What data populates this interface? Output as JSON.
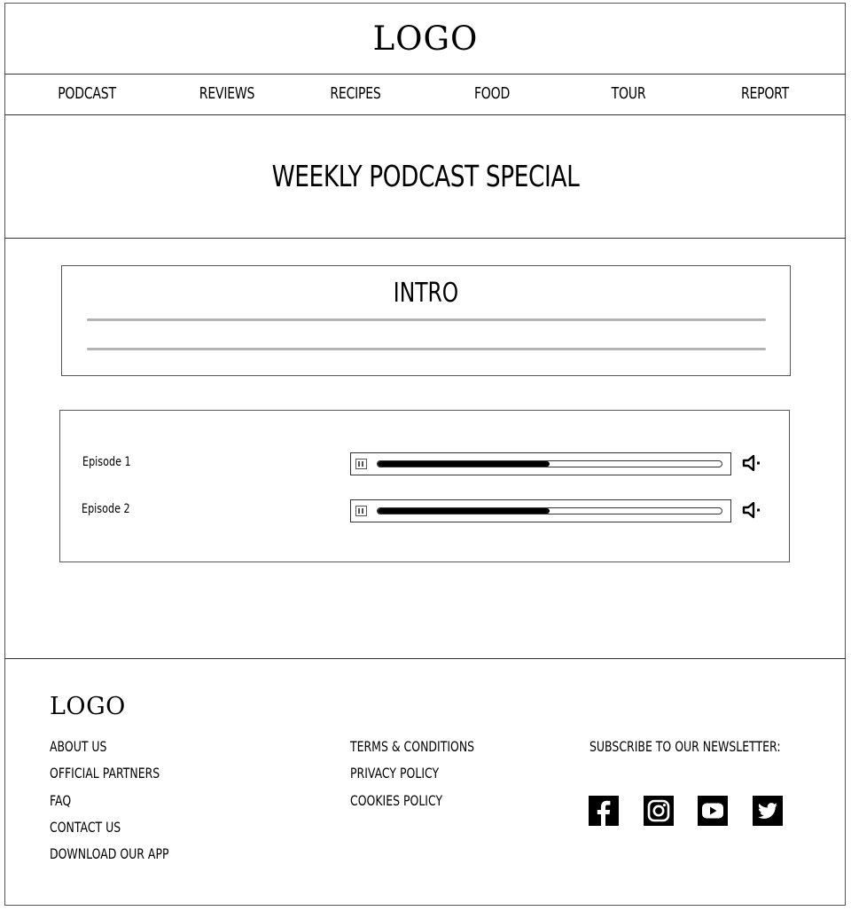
{
  "header": {
    "logo": "LOGO"
  },
  "nav": {
    "items": [
      {
        "label": "PODCAST"
      },
      {
        "label": "REVIEWS"
      },
      {
        "label": "RECIPES"
      },
      {
        "label": "FOOD"
      },
      {
        "label": "TOUR"
      },
      {
        "label": "REPORT"
      }
    ]
  },
  "main": {
    "title": "WEEKLY PODCAST SPECIAL",
    "intro": {
      "title": "INTRO"
    },
    "episodes": [
      {
        "label": "Episode 1",
        "progress": 0.5,
        "play_icon": "pause-icon",
        "volume_icon": "speaker-icon"
      },
      {
        "label": "Episode 2",
        "progress": 0.5,
        "play_icon": "pause-icon",
        "volume_icon": "speaker-icon"
      }
    ]
  },
  "footer": {
    "logo": "LOGO",
    "col1": [
      "ABOUT US",
      "OFFICIAL PARTNERS",
      "FAQ",
      "CONTACT US",
      "DOWNLOAD OUR APP"
    ],
    "col2": [
      "TERMS & CONDITIONS",
      "PRIVACY POLICY",
      "COOKIES POLICY"
    ],
    "newsletter": "SUBSCRIBE TO OUR NEWSLETTER:",
    "social": [
      "facebook-icon",
      "instagram-icon",
      "youtube-icon",
      "twitter-icon"
    ]
  },
  "colors": {
    "text": "#000000",
    "rule": "#b3b3b3",
    "border": "#555555"
  }
}
